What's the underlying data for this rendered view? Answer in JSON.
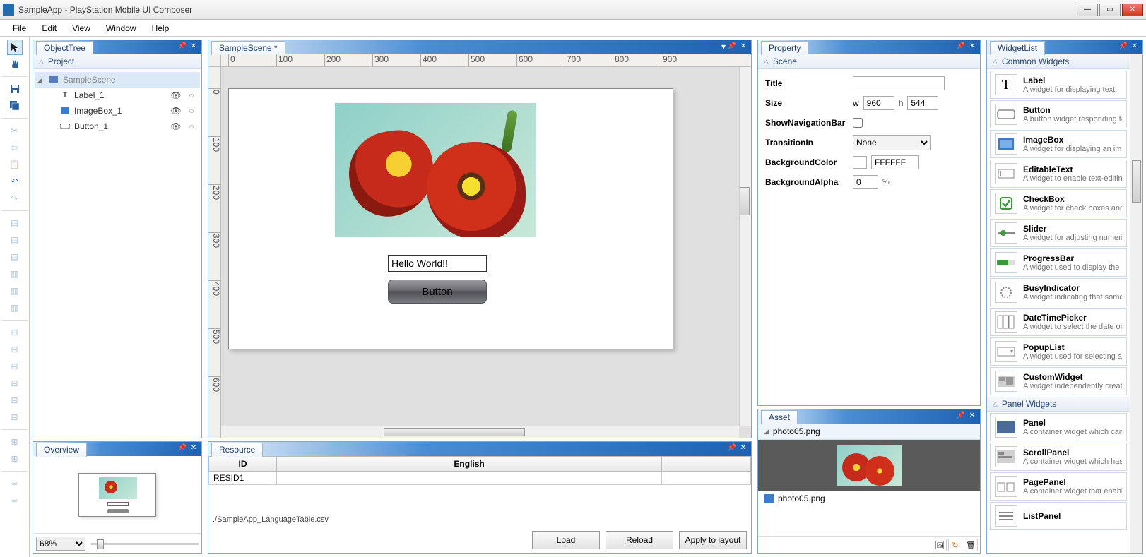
{
  "window": {
    "title": "SampleApp - PlayStation Mobile UI Composer"
  },
  "menu": {
    "file": "File",
    "edit": "Edit",
    "view": "View",
    "window": "Window",
    "help": "Help"
  },
  "objectTree": {
    "tab": "ObjectTree",
    "section": "Project",
    "items": [
      {
        "label": "SampleScene",
        "icon": "scene",
        "indent": 0,
        "expanded": true,
        "vis": "",
        "lock": ""
      },
      {
        "label": "Label_1",
        "icon": "T",
        "indent": 1,
        "vis": "eye",
        "lock": "dot"
      },
      {
        "label": "ImageBox_1",
        "icon": "img",
        "indent": 1,
        "vis": "eye",
        "lock": "dot"
      },
      {
        "label": "Button_1",
        "icon": "btn",
        "indent": 1,
        "vis": "eye",
        "lock": "dot"
      }
    ]
  },
  "overview": {
    "tab": "Overview",
    "zoom": "68%"
  },
  "scene": {
    "tab": "SampleScene *",
    "ruler_ticks": [
      "0",
      "100",
      "200",
      "300",
      "400",
      "500",
      "600",
      "700",
      "800",
      "900"
    ],
    "label_text": "Hello World!!",
    "button_text": "Button"
  },
  "resource": {
    "tab": "Resource",
    "cols": [
      "ID",
      "English"
    ],
    "row1_id": "RESID1",
    "row1_en": "",
    "path": "./SampleApp_LanguageTable.csv",
    "btn_load": "Load",
    "btn_reload": "Reload",
    "btn_apply": "Apply to layout"
  },
  "property": {
    "tab": "Property",
    "section": "Scene",
    "labels": {
      "title": "Title",
      "size": "Size",
      "w": "w",
      "h": "h",
      "shownav": "ShowNavigationBar",
      "transition": "TransitionIn",
      "bgcolor": "BackgroundColor",
      "bgalpha": "BackgroundAlpha",
      "percent": "%"
    },
    "values": {
      "title": "",
      "w": "960",
      "h": "544",
      "shownav": false,
      "transition": "None",
      "bgcolor": "FFFFFF",
      "bgalpha": "0"
    }
  },
  "asset": {
    "tab": "Asset",
    "header_file": "photo05.png",
    "list_file": "photo05.png"
  },
  "widgets": {
    "tab": "WidgetList",
    "section_common": "Common Widgets",
    "section_panel": "Panel Widgets",
    "common": [
      {
        "name": "Label",
        "desc": "A widget for displaying text",
        "icon": "T"
      },
      {
        "name": "Button",
        "desc": "A button widget responding to",
        "icon": "btn"
      },
      {
        "name": "ImageBox",
        "desc": "A widget for displaying an ima",
        "icon": "img"
      },
      {
        "name": "EditableText",
        "desc": "A widget to enable text-editing",
        "icon": "edit"
      },
      {
        "name": "CheckBox",
        "desc": "A widget for check boxes and i",
        "icon": "check"
      },
      {
        "name": "Slider",
        "desc": "A widget for adjusting numeric",
        "icon": "slider"
      },
      {
        "name": "ProgressBar",
        "desc": "A widget used to display the p",
        "icon": "progress"
      },
      {
        "name": "BusyIndicator",
        "desc": "A widget indicating that some",
        "icon": "busy"
      },
      {
        "name": "DateTimePicker",
        "desc": "A widget to select the date or",
        "icon": "date"
      },
      {
        "name": "PopupList",
        "desc": "A widget used for selecting an",
        "icon": "popup"
      },
      {
        "name": "CustomWidget",
        "desc": "A widget independently create",
        "icon": "custom"
      }
    ],
    "panel": [
      {
        "name": "Panel",
        "desc": "A container widget which can s",
        "icon": "panel"
      },
      {
        "name": "ScrollPanel",
        "desc": "A container widget which has t",
        "icon": "scroll"
      },
      {
        "name": "PagePanel",
        "desc": "A container widget that enable",
        "icon": "page"
      },
      {
        "name": "ListPanel",
        "desc": "",
        "icon": "list"
      }
    ]
  }
}
